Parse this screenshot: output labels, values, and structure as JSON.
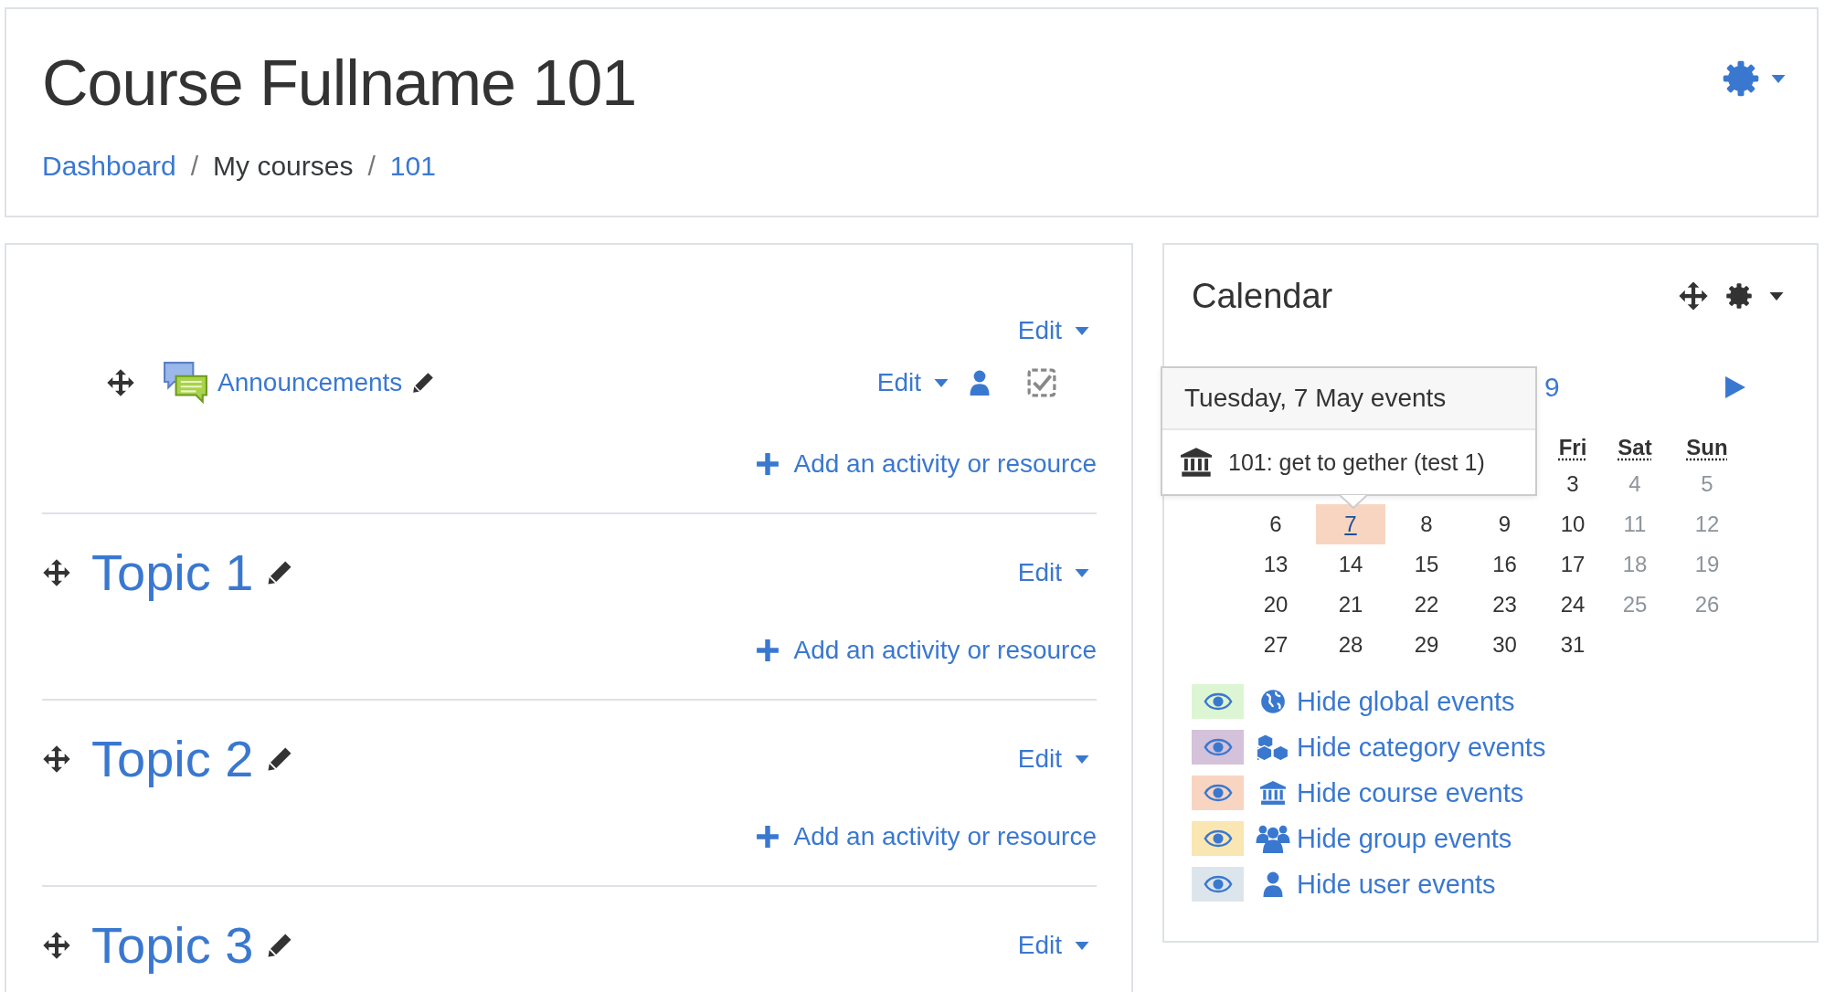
{
  "header": {
    "title": "Course Fullname 101",
    "breadcrumb": [
      {
        "label": "Dashboard",
        "link": true
      },
      {
        "separator": "/",
        "label": "My courses",
        "link": false
      },
      {
        "separator": "/",
        "label": "101",
        "link": true
      }
    ]
  },
  "sections": [
    {
      "edit": "Edit",
      "activities": [
        {
          "name": "Announcements",
          "edit": "Edit"
        }
      ],
      "add": "Add an activity or resource"
    },
    {
      "title": "Topic 1",
      "edit": "Edit",
      "add": "Add an activity or resource"
    },
    {
      "title": "Topic 2",
      "edit": "Edit",
      "add": "Add an activity or resource"
    },
    {
      "title": "Topic 3",
      "edit": "Edit"
    }
  ],
  "calendar": {
    "title": "Calendar",
    "month": "9",
    "weekday_headers": [
      "Fri",
      "Sat",
      "Sun"
    ],
    "weeks": [
      [
        {
          "day": "3",
          "weekend": false,
          "event": false
        },
        {
          "day": "4",
          "weekend": true,
          "event": false
        },
        {
          "day": "5",
          "weekend": true,
          "event": false
        }
      ],
      [
        {
          "day": "6",
          "weekend": false,
          "event": false
        },
        {
          "day": "7",
          "weekend": false,
          "event": true
        },
        {
          "day": "8",
          "weekend": false,
          "event": false
        },
        {
          "day": "9",
          "weekend": false,
          "event": false
        },
        {
          "day": "10",
          "weekend": false,
          "event": false
        },
        {
          "day": "11",
          "weekend": true,
          "event": false
        },
        {
          "day": "12",
          "weekend": true,
          "event": false
        }
      ],
      [
        {
          "day": "13",
          "weekend": false,
          "event": false
        },
        {
          "day": "14",
          "weekend": false,
          "event": false
        },
        {
          "day": "15",
          "weekend": false,
          "event": false
        },
        {
          "day": "16",
          "weekend": false,
          "event": false
        },
        {
          "day": "17",
          "weekend": false,
          "event": false
        },
        {
          "day": "18",
          "weekend": true,
          "event": false
        },
        {
          "day": "19",
          "weekend": true,
          "event": false
        }
      ],
      [
        {
          "day": "20",
          "weekend": false,
          "event": false
        },
        {
          "day": "21",
          "weekend": false,
          "event": false
        },
        {
          "day": "22",
          "weekend": false,
          "event": false
        },
        {
          "day": "23",
          "weekend": false,
          "event": false
        },
        {
          "day": "24",
          "weekend": false,
          "event": false
        },
        {
          "day": "25",
          "weekend": true,
          "event": false
        },
        {
          "day": "26",
          "weekend": true,
          "event": false
        }
      ],
      [
        {
          "day": "27",
          "weekend": false,
          "event": false
        },
        {
          "day": "28",
          "weekend": false,
          "event": false
        },
        {
          "day": "29",
          "weekend": false,
          "event": false
        },
        {
          "day": "30",
          "weekend": false,
          "event": false
        },
        {
          "day": "31",
          "weekend": false,
          "event": false
        }
      ]
    ],
    "tooltip": {
      "title": "Tuesday, 7 May events",
      "events": [
        {
          "label": "101: get to gether (test 1)",
          "kind": "course"
        }
      ]
    },
    "legend": [
      {
        "label": "Hide global events",
        "kind": "global",
        "color": "#dcf5d3"
      },
      {
        "label": "Hide category events",
        "kind": "category",
        "color": "#d4c1da"
      },
      {
        "label": "Hide course events",
        "kind": "course",
        "color": "#f8d5c1"
      },
      {
        "label": "Hide group events",
        "kind": "group",
        "color": "#fae6b3"
      },
      {
        "label": "Hide user events",
        "kind": "user",
        "color": "#dde5ec"
      }
    ]
  }
}
